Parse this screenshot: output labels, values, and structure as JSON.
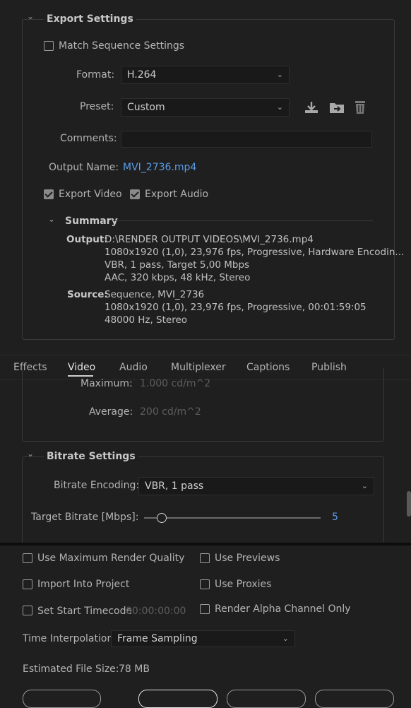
{
  "export_settings": {
    "title": "Export Settings",
    "match_sequence_label": "Match Sequence Settings",
    "format_label": "Format:",
    "format_value": "H.264",
    "preset_label": "Preset:",
    "preset_value": "Custom",
    "comments_label": "Comments:",
    "comments_value": "",
    "output_name_label": "Output Name:",
    "output_name_value": "MVI_2736.mp4",
    "export_video_label": "Export Video",
    "export_audio_label": "Export Audio"
  },
  "summary": {
    "title": "Summary",
    "output_label": "Output:",
    "output_lines": [
      "D:\\RENDER OUTPUT VIDEOS\\MVI_2736.mp4",
      "1080x1920 (1,0), 23,976 fps, Progressive, Hardware Encodin...",
      "VBR, 1 pass, Target 5,00 Mbps",
      "AAC, 320 kbps, 48 kHz, Stereo"
    ],
    "source_label": "Source:",
    "source_lines": [
      "Sequence, MVI_2736",
      "1080x1920 (1,0), 23,976 fps, Progressive, 00:01:59:05",
      "48000 Hz, Stereo"
    ]
  },
  "tabs": [
    "Effects",
    "Video",
    "Audio",
    "Multiplexer",
    "Captions",
    "Publish"
  ],
  "hdr": {
    "maximum_label": "Maximum:",
    "maximum_value": "1.000 cd/m^2",
    "average_label": "Average:",
    "average_value": "200 cd/m^2"
  },
  "bitrate": {
    "title": "Bitrate Settings",
    "encoding_label": "Bitrate Encoding:",
    "encoding_value": "VBR, 1 pass",
    "target_label": "Target Bitrate [Mbps]:",
    "target_value": "5",
    "target_fraction": 0.1
  },
  "options": {
    "max_render_quality": "Use Maximum Render Quality",
    "use_previews": "Use Previews",
    "import_into_project": "Import Into Project",
    "use_proxies": "Use Proxies",
    "set_start_timecode": "Set Start Timecode",
    "start_timecode_value": "00:00:00:00",
    "render_alpha": "Render Alpha Channel Only",
    "time_interp_label": "Time Interpolation:",
    "time_interp_value": "Frame Sampling",
    "est_size_label": "Estimated File Size:",
    "est_size_value": "78 MB"
  },
  "colors": {
    "background": "#1f1f1f",
    "accent_link": "#5a9ce8"
  }
}
